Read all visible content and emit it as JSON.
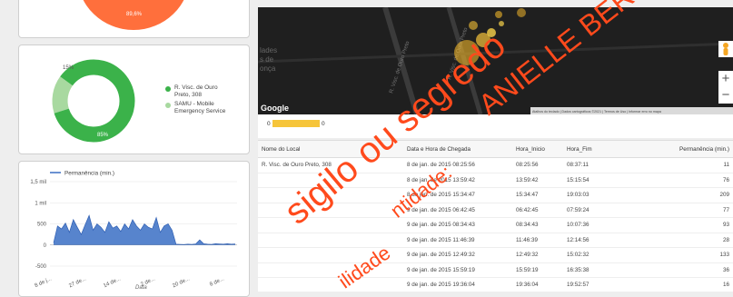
{
  "pie_top": {
    "slice_label": "89,6%",
    "color": "#ff6f3c"
  },
  "donut": {
    "legend": [
      {
        "label_line1": "R. Visc. de Ouro",
        "label_line2": "Preto, 308",
        "color": "#3bb24a"
      },
      {
        "label_line1": "SAMU - Mobile",
        "label_line2": "Emergency Service",
        "color": "#a8d9a0"
      }
    ],
    "values": [
      85,
      15
    ],
    "slice_labels": [
      "85%",
      "15%"
    ]
  },
  "line_chart": {
    "legend": "Permanência (min.)",
    "y_ticks": [
      "1,5 mil",
      "1 mil",
      "500",
      "0",
      "-500"
    ],
    "x_ticks": [
      "8 de j...",
      "27 de...",
      "14 de...",
      "2 de...",
      "20 de...",
      "8 de..."
    ],
    "xlabel": "Data"
  },
  "chart_data": {
    "type": "line",
    "title": "",
    "xlabel": "Data",
    "ylabel": "",
    "ylim": [
      -500,
      1500
    ],
    "series": [
      {
        "name": "Permanência (min.)",
        "description_values_approx": [
          50,
          450,
          380,
          520,
          300,
          600,
          420,
          250,
          480,
          700,
          350,
          500,
          420,
          300,
          550,
          400,
          450,
          320,
          500,
          380,
          600,
          450,
          350,
          500,
          420,
          380,
          650,
          300,
          450,
          500,
          350,
          20,
          15,
          10,
          20,
          15,
          25,
          120,
          30,
          20,
          15,
          30,
          25,
          20,
          30,
          20,
          25
        ]
      }
    ]
  },
  "map": {
    "street1": "R. Visc. de Ouro Preto",
    "street2": "R. Visc. de Ouro Preto",
    "area1": "lades",
    "area2": "s de",
    "area3": "onça",
    "google": "Google",
    "attribution": "Atalhos do teclado | Dados cartográficos ©2021 | Termos de Uso | Informar erro no mapa",
    "zoom_in": "+",
    "zoom_out": "−"
  },
  "range": {
    "min": "0",
    "max": "0"
  },
  "table": {
    "headers": [
      "Nome do Local",
      "Data e Hora de Chegada",
      "Hora_Inicio",
      "Hora_Fim",
      "Permanência (min.)"
    ],
    "rows": [
      [
        "R. Visc. de Ouro Preto, 308",
        "8 de jan. de 2015 08:25:56",
        "08:25:56",
        "08:37:11",
        "11"
      ],
      [
        "",
        "8 de jan. de 2015 13:59:42",
        "13:59:42",
        "15:15:54",
        "76"
      ],
      [
        "",
        "8 de jan. de 2015 15:34:47",
        "15:34:47",
        "19:03:03",
        "209"
      ],
      [
        "",
        "9 de jan. de 2015 06:42:45",
        "06:42:45",
        "07:59:24",
        "77"
      ],
      [
        "",
        "9 de jan. de 2015 08:34:43",
        "08:34:43",
        "10:07:36",
        "93"
      ],
      [
        "",
        "9 de jan. de 2015 11:46:39",
        "11:46:39",
        "12:14:56",
        "28"
      ],
      [
        "",
        "9 de jan. de 2015 12:49:32",
        "12:49:32",
        "15:02:32",
        "133"
      ],
      [
        "",
        "9 de jan. de 2015 15:59:19",
        "15:59:19",
        "16:35:38",
        "36"
      ],
      [
        "",
        "9 de jan. de 2015 19:36:04",
        "19:36:04",
        "19:52:57",
        "16"
      ]
    ]
  },
  "watermark": {
    "line1": "sigilo ou segredo",
    "line2": "ANIELLE BERT",
    "line3": "ntidade:",
    "line4": "ilidade"
  }
}
